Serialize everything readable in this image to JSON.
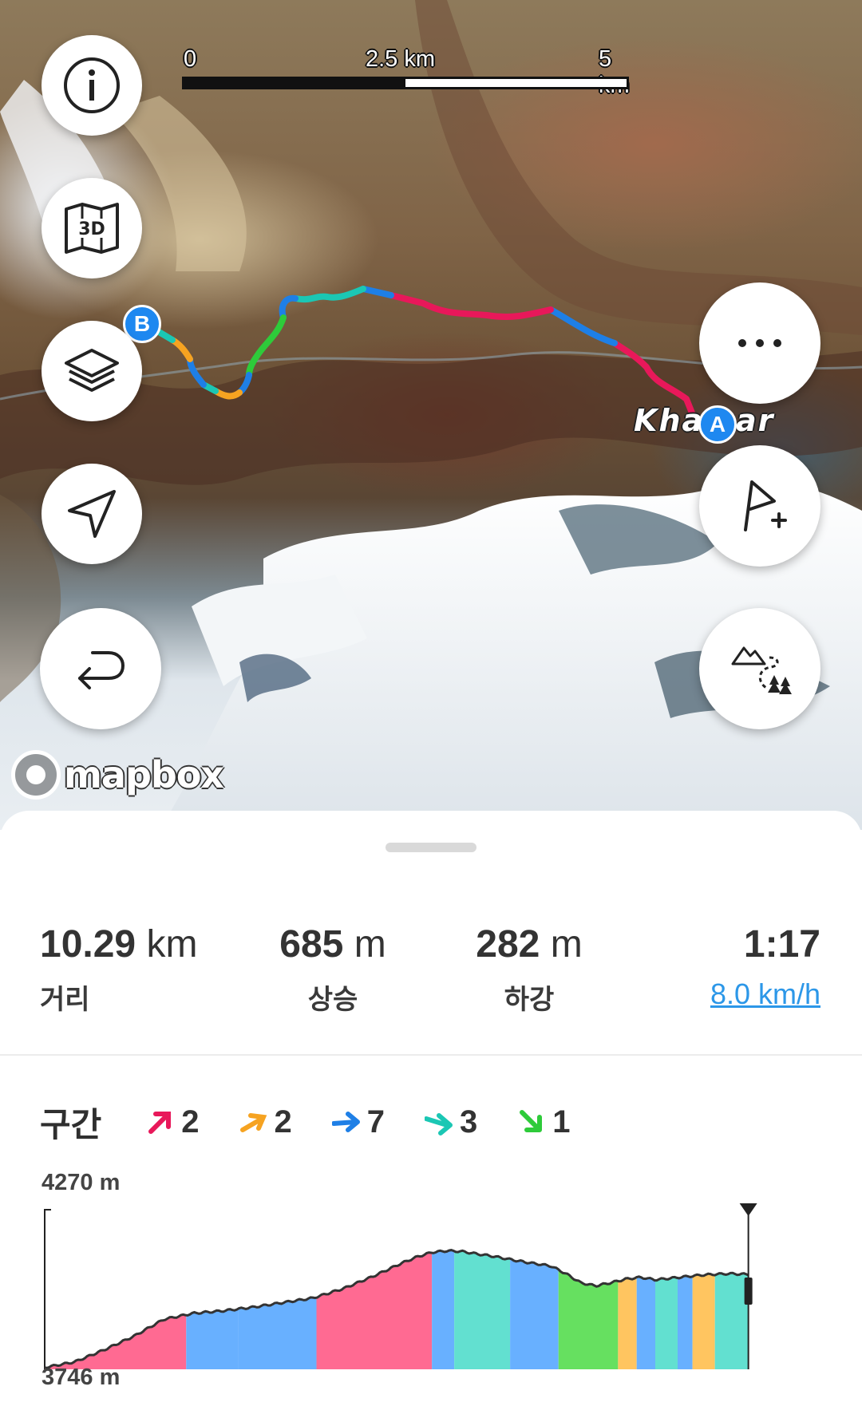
{
  "map": {
    "scale": {
      "label_0": "0",
      "label_mid": "2.5 km",
      "label_end": "5 km"
    },
    "place_label": "Kha  sar",
    "marker_start": "A",
    "marker_end": "B",
    "attribution": "mapbox",
    "buttons": {
      "info": "info-icon",
      "view_3d": "3d-map-icon",
      "layers": "layers-icon",
      "locate": "navigation-arrow-icon",
      "reverse": "reverse-route-icon",
      "more": "more-dots-icon",
      "add_waypoint": "add-flag-icon",
      "terrain": "terrain-trail-icon"
    },
    "route_colors": [
      "#1e7fe6",
      "#e8185a",
      "#1bc7b4",
      "#f6a321",
      "#2ecb3a"
    ]
  },
  "summary": {
    "distance": {
      "value": "10.29",
      "unit": "km",
      "label": "거리"
    },
    "ascent": {
      "value": "685",
      "unit": "m",
      "label": "상승"
    },
    "descent": {
      "value": "282",
      "unit": "m",
      "label": "하강"
    },
    "duration": {
      "value": "1:17",
      "speed": "8.0 km/h"
    }
  },
  "segments": {
    "title": "구간",
    "items": [
      {
        "type": "steep-up",
        "color": "#e8185a",
        "count": "2"
      },
      {
        "type": "up",
        "color": "#f6a321",
        "count": "2"
      },
      {
        "type": "flat",
        "color": "#1e7fe6",
        "count": "7"
      },
      {
        "type": "down",
        "color": "#1bc7b4",
        "count": "3"
      },
      {
        "type": "steep-down",
        "color": "#2ecb3a",
        "count": "1"
      }
    ]
  },
  "elevation": {
    "max_label": "4270 m",
    "min_label": "3746 m",
    "profile": {
      "x_km": [
        0,
        0.4,
        0.8,
        1.2,
        1.6,
        2.0,
        2.4,
        2.8,
        3.2,
        3.6,
        4.0,
        4.4,
        4.8,
        5.0,
        5.2,
        5.4,
        5.6,
        5.8,
        6.0,
        6.4,
        6.8,
        7.0,
        7.2,
        7.4,
        7.6,
        7.8,
        8.0,
        8.2,
        8.4,
        8.6,
        8.8,
        9.0,
        9.2,
        9.4,
        9.6,
        9.8,
        10.0,
        10.29
      ],
      "elev_m": [
        3752,
        3770,
        3810,
        3855,
        3910,
        3930,
        3938,
        3950,
        3965,
        3980,
        4010,
        4050,
        4095,
        4115,
        4130,
        4135,
        4133,
        4125,
        4118,
        4100,
        4085,
        4060,
        4030,
        4020,
        4030,
        4042,
        4048,
        4040,
        4045,
        4050,
        4055,
        4058,
        4060,
        4058,
        4055,
        4052,
        4050,
        4048
      ]
    },
    "segment_bands": [
      {
        "from_km": 0.0,
        "to_km": 1.9,
        "color": "#ff6a92"
      },
      {
        "from_km": 1.9,
        "to_km": 2.6,
        "color": "#68b0ff"
      },
      {
        "from_km": 2.6,
        "to_km": 3.65,
        "color": "#68b0ff"
      },
      {
        "from_km": 3.65,
        "to_km": 5.2,
        "color": "#ff6a92"
      },
      {
        "from_km": 5.2,
        "to_km": 5.5,
        "color": "#68b0ff"
      },
      {
        "from_km": 5.5,
        "to_km": 6.25,
        "color": "#62e0d0"
      },
      {
        "from_km": 6.25,
        "to_km": 6.9,
        "color": "#68b0ff"
      },
      {
        "from_km": 6.9,
        "to_km": 7.7,
        "color": "#66e060"
      },
      {
        "from_km": 7.7,
        "to_km": 7.95,
        "color": "#ffc560"
      },
      {
        "from_km": 7.95,
        "to_km": 8.2,
        "color": "#68b0ff"
      },
      {
        "from_km": 8.2,
        "to_km": 8.5,
        "color": "#62e0d0"
      },
      {
        "from_km": 8.5,
        "to_km": 8.7,
        "color": "#68b0ff"
      },
      {
        "from_km": 8.7,
        "to_km": 9.0,
        "color": "#ffc560"
      },
      {
        "from_km": 9.0,
        "to_km": 9.45,
        "color": "#62e0d0"
      }
    ]
  }
}
